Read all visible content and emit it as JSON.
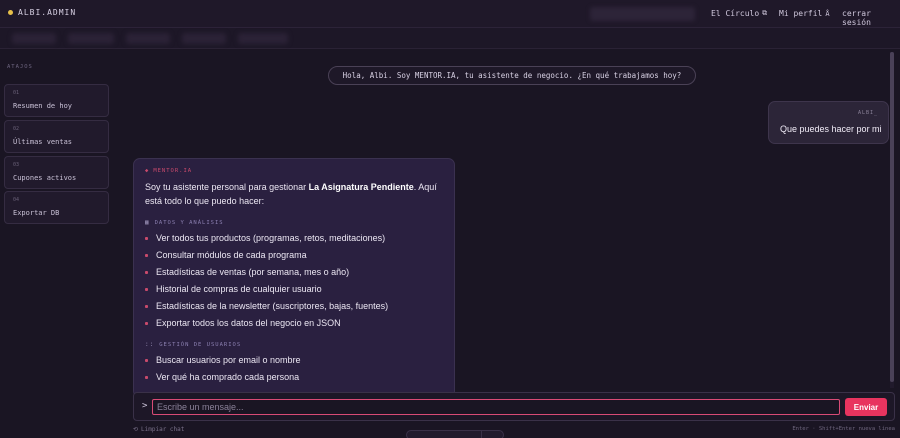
{
  "topbar": {
    "brand": "ALBI.ADMIN",
    "nav": [
      {
        "label": "El Círculo",
        "icon": "external-link-icon",
        "icon_glyph": "⧉"
      },
      {
        "label": "Mi perfil",
        "icon": "user-icon",
        "icon_glyph": "Å"
      },
      {
        "label": "cerrar sesión"
      }
    ]
  },
  "sidebar": {
    "title": "ATAJOS",
    "items": [
      {
        "num": "01",
        "label": "Resumen de hoy"
      },
      {
        "num": "02",
        "label": "Últimas ventas"
      },
      {
        "num": "03",
        "label": "Cupones activos"
      },
      {
        "num": "04",
        "label": "Exportar DB"
      }
    ]
  },
  "chat": {
    "greeting": "Hola, Albi. Soy MENTOR.IA, tu asistente de negocio. ¿En qué trabajamos hoy?",
    "user": {
      "name": "ALBI_",
      "text": "Que puedes hacer por mi"
    },
    "bot": {
      "name": "MENTOR.IA",
      "intro_pre": "Soy tu asistente personal para gestionar ",
      "intro_bold": "La Asignatura Pendiente",
      "intro_post": ". Aquí está todo lo que puedo hacer:",
      "sections": [
        {
          "icon": "chart-icon",
          "icon_glyph": "▦",
          "title": "DATOS Y ANÁLISIS",
          "items": [
            "Ver todos tus productos (programas, retos, meditaciones)",
            "Consultar módulos de cada programa",
            "Estadísticas de ventas (por semana, mes o año)",
            "Historial de compras de cualquier usuario",
            "Estadísticas de la newsletter (suscriptores, bajas, fuentes)",
            "Exportar todos los datos del negocio en JSON"
          ]
        },
        {
          "icon": "users-icon",
          "icon_glyph": "::",
          "title": "GESTIÓN DE USUARIOS",
          "items": [
            "Buscar usuarios por email o nombre",
            "Ver qué ha comprado cada persona"
          ]
        }
      ]
    }
  },
  "composer": {
    "prompt": ">",
    "placeholder": "Escribe un mensaje...",
    "send_label": "Enviar",
    "clear_label": "Limpiar chat",
    "hint": "Enter · Shift+Enter nueva línea"
  },
  "colors": {
    "accent": "#e8345f",
    "brand_dot": "#e8c14a",
    "background": "#1a1523"
  }
}
